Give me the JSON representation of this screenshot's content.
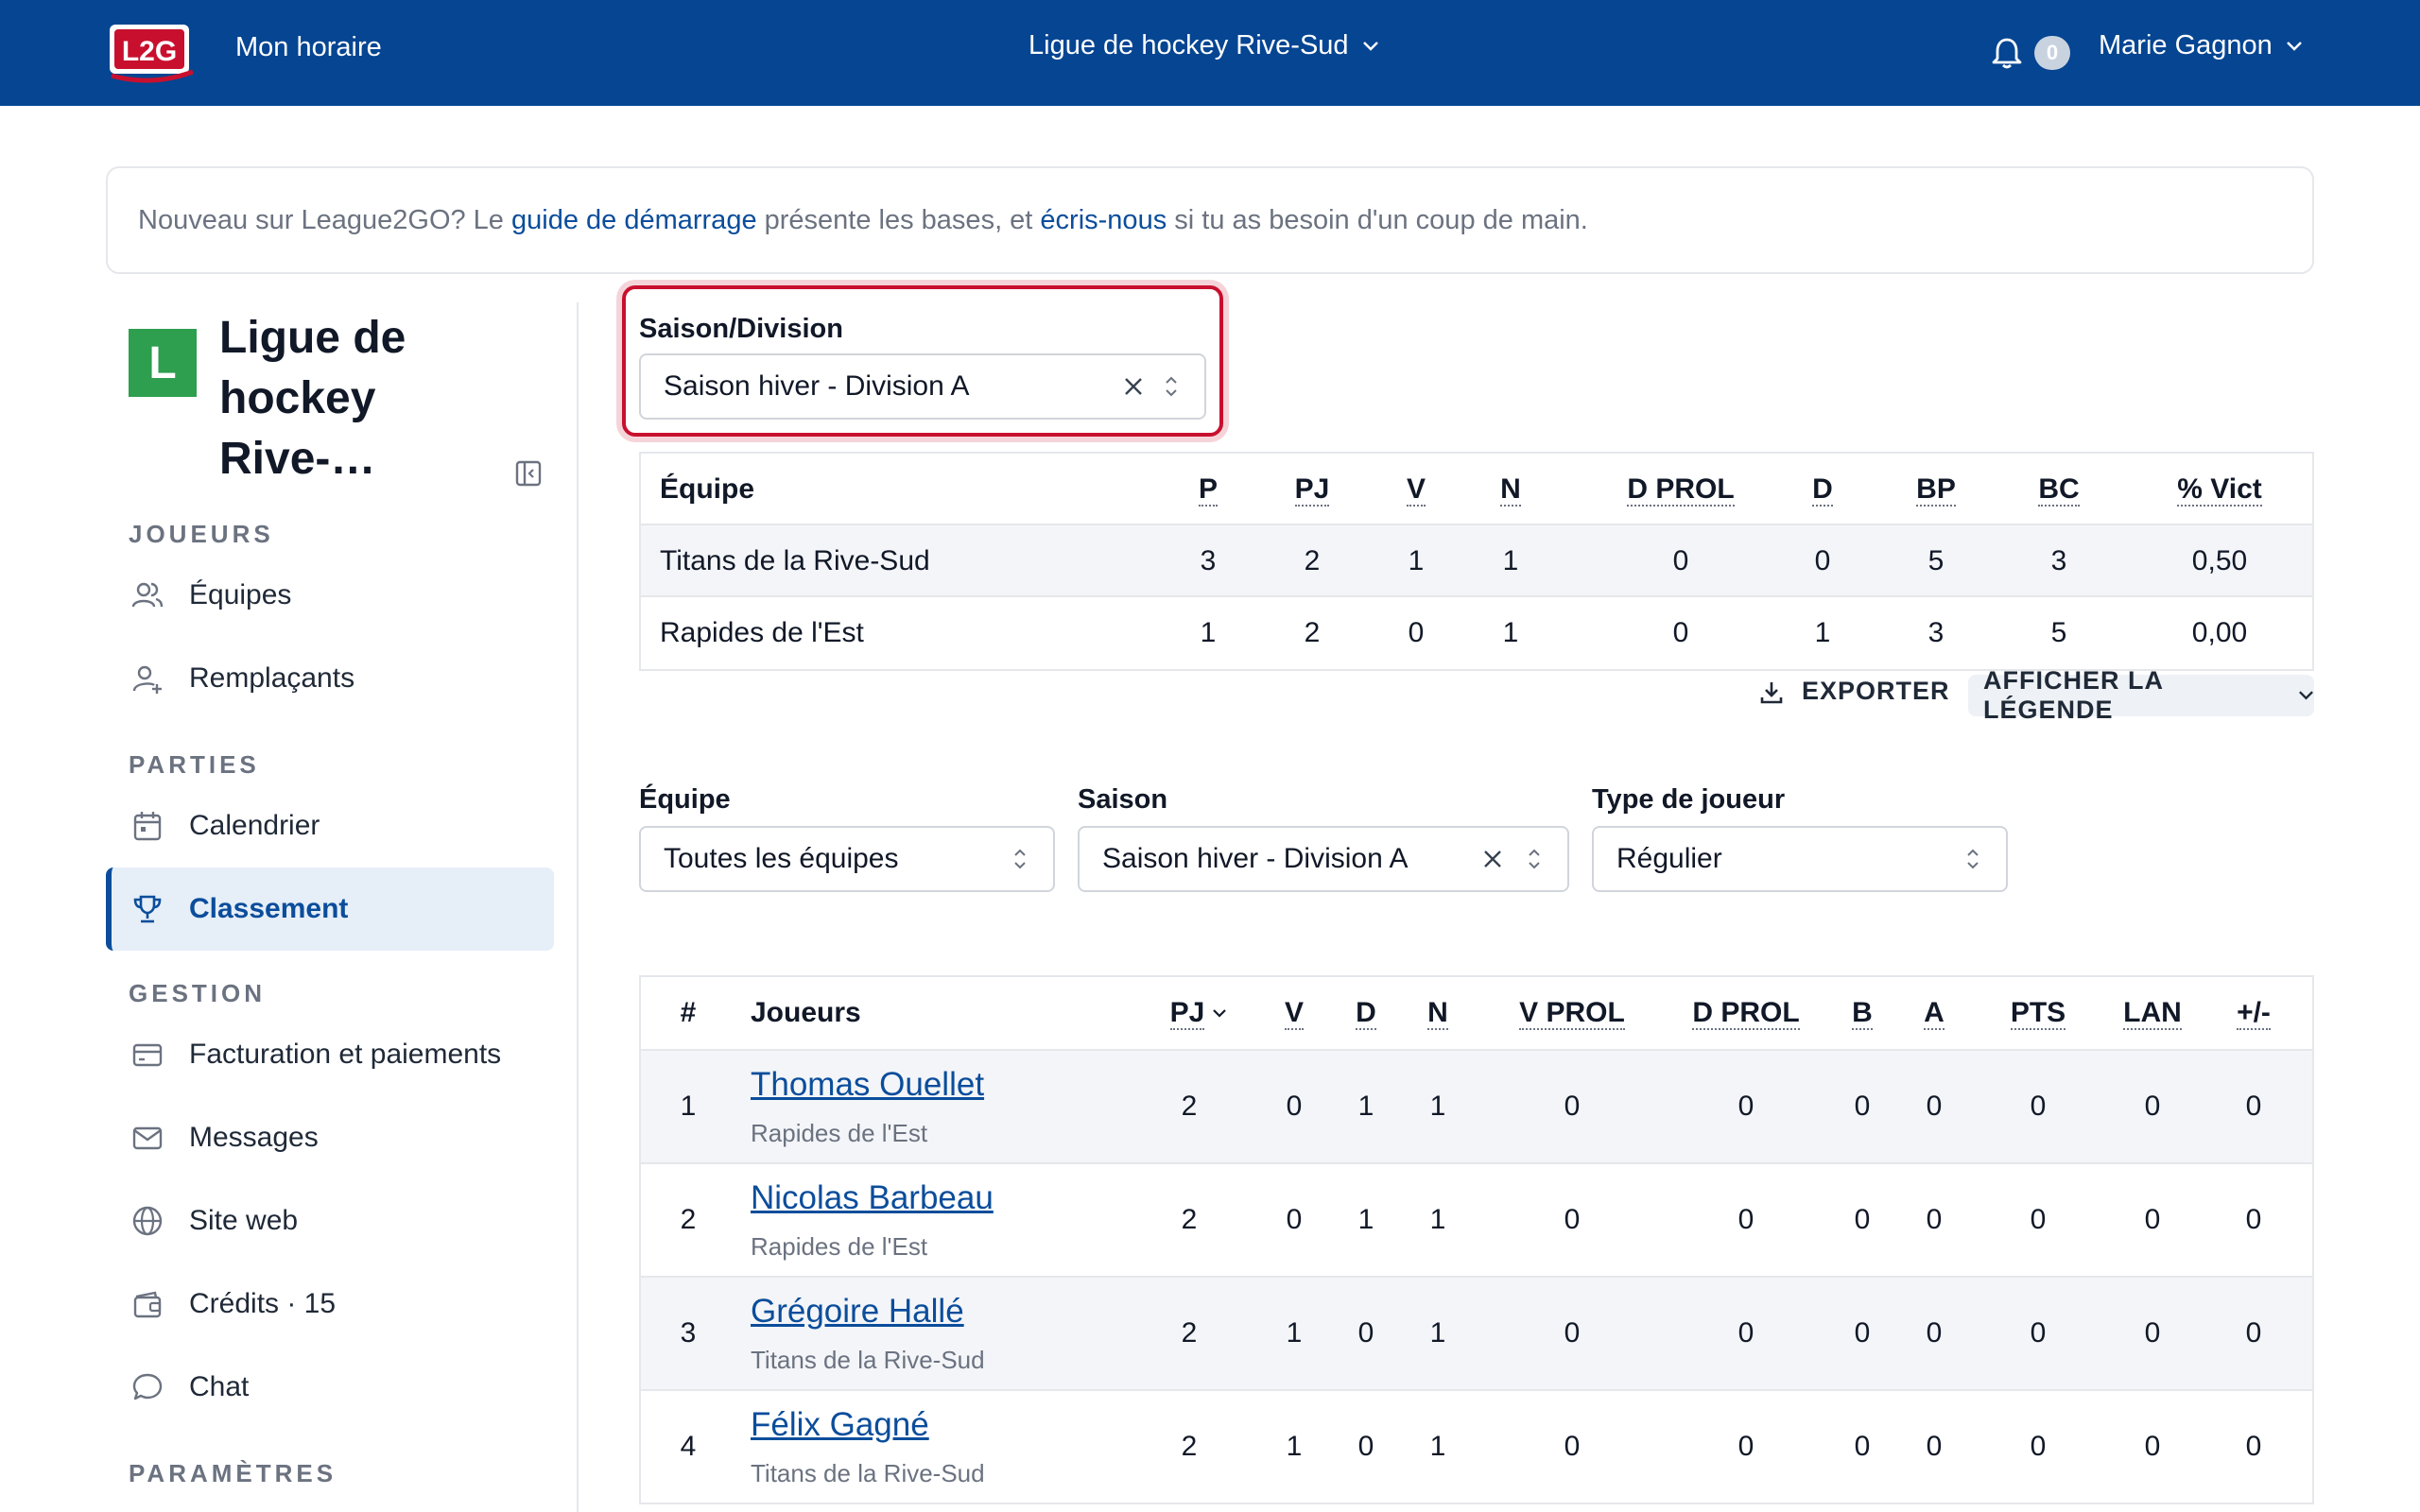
{
  "topbar": {
    "logo_text": "L2G",
    "schedule_link": "Mon horaire",
    "league_select": "Ligue de hockey Rive-Sud",
    "notification_count": "0",
    "user_name": "Marie Gagnon"
  },
  "notice": {
    "prefix": "Nouveau sur League2GO? Le ",
    "guide_link": "guide de démarrage",
    "middle": " présente les bases, et ",
    "contact_link": "écris-nous",
    "suffix": " si tu as besoin d'un coup de main."
  },
  "sidebar": {
    "badge_letter": "L",
    "org_name": "Ligue de hockey Rive-…",
    "sections": {
      "players": "JOUEURS",
      "games": "PARTIES",
      "management": "GESTION",
      "settings": "PARAMÈTRES"
    },
    "items": {
      "teams": "Équipes",
      "substitutes": "Remplaçants",
      "calendar": "Calendrier",
      "standings": "Classement",
      "billing": "Facturation et paiements",
      "messages": "Messages",
      "website": "Site web",
      "credits": "Crédits · 15",
      "chat": "Chat"
    }
  },
  "season_division": {
    "label": "Saison/Division",
    "value": "Saison hiver - Division A"
  },
  "standings": {
    "headers": [
      "Équipe",
      "P",
      "PJ",
      "V",
      "N",
      "D PROL",
      "D",
      "BP",
      "BC",
      "% Vict"
    ],
    "rows": [
      [
        "Titans de la Rive-Sud",
        "3",
        "2",
        "1",
        "1",
        "0",
        "0",
        "5",
        "3",
        "0,50"
      ],
      [
        "Rapides de l'Est",
        "1",
        "2",
        "0",
        "1",
        "0",
        "1",
        "3",
        "5",
        "0,00"
      ]
    ],
    "export_label": "EXPORTER",
    "legend_label": "AFFICHER LA LÉGENDE"
  },
  "filters": {
    "team": {
      "label": "Équipe",
      "value": "Toutes les équipes"
    },
    "season": {
      "label": "Saison",
      "value": "Saison hiver - Division A"
    },
    "player_type": {
      "label": "Type de joueur",
      "value": "Régulier"
    }
  },
  "players": {
    "headers": [
      "#",
      "Joueurs",
      "PJ",
      "V",
      "D",
      "N",
      "V PROL",
      "D PROL",
      "B",
      "A",
      "PTS",
      "LAN",
      "+/-"
    ],
    "rows": [
      {
        "rank": "1",
        "name": "Thomas Ouellet",
        "team": "Rapides de l'Est",
        "stats": [
          "2",
          "0",
          "1",
          "1",
          "0",
          "0",
          "0",
          "0",
          "0",
          "0",
          "0"
        ]
      },
      {
        "rank": "2",
        "name": "Nicolas Barbeau",
        "team": "Rapides de l'Est",
        "stats": [
          "2",
          "0",
          "1",
          "1",
          "0",
          "0",
          "0",
          "0",
          "0",
          "0",
          "0"
        ]
      },
      {
        "rank": "3",
        "name": "Grégoire Hallé",
        "team": "Titans de la Rive-Sud",
        "stats": [
          "2",
          "1",
          "0",
          "1",
          "0",
          "0",
          "0",
          "0",
          "0",
          "0",
          "0"
        ]
      },
      {
        "rank": "4",
        "name": "Félix Gagné",
        "team": "Titans de la Rive-Sud",
        "stats": [
          "2",
          "1",
          "0",
          "1",
          "0",
          "0",
          "0",
          "0",
          "0",
          "0",
          "0"
        ]
      }
    ]
  }
}
